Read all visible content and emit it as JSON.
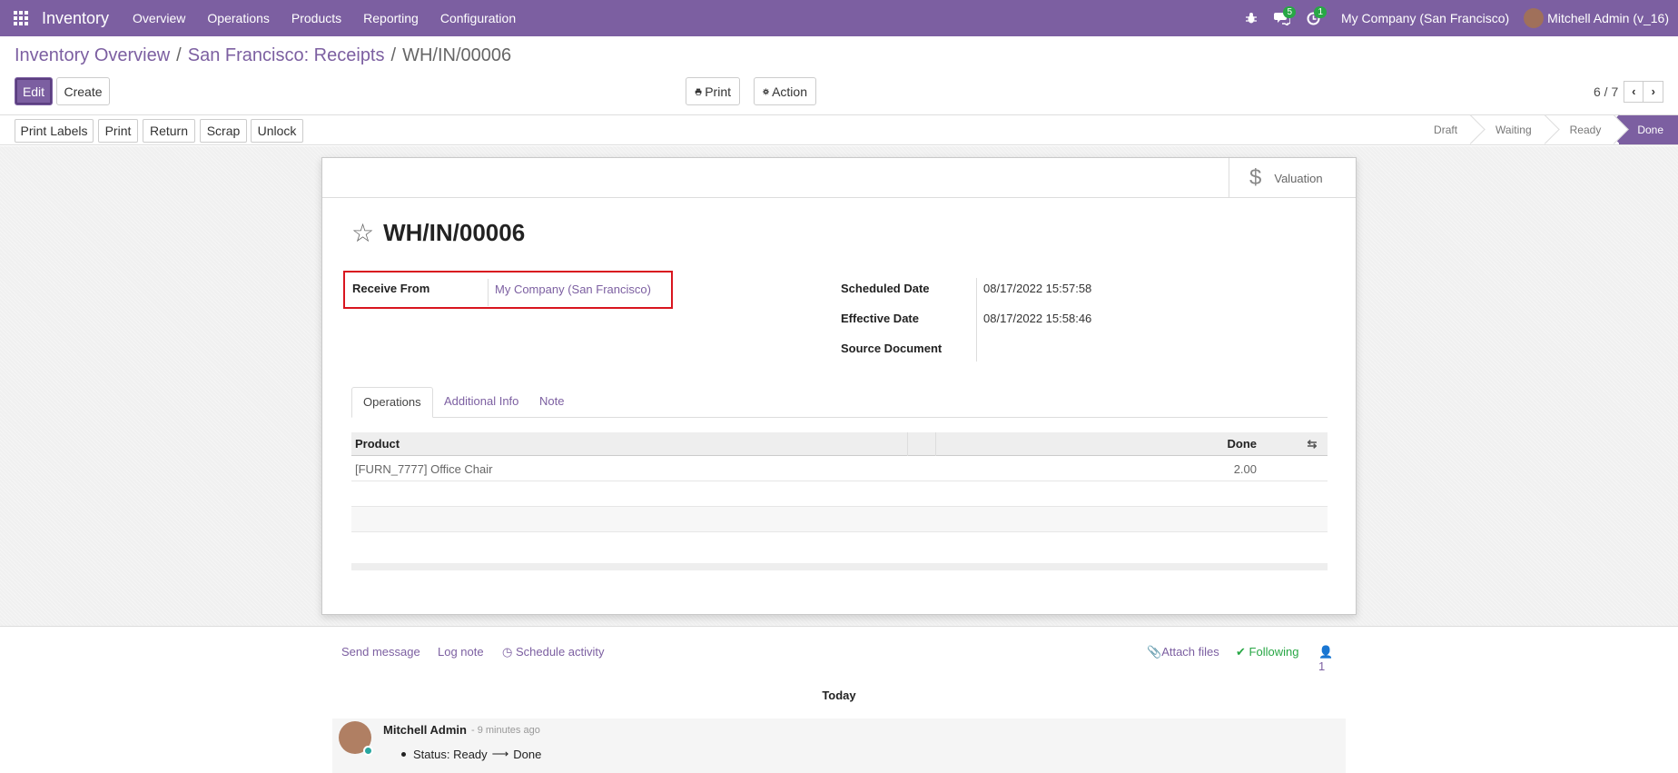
{
  "navbar": {
    "brand": "Inventory",
    "menu": [
      "Overview",
      "Operations",
      "Products",
      "Reporting",
      "Configuration"
    ],
    "messages_badge": "5",
    "activities_badge": "1",
    "company": "My Company (San Francisco)",
    "user": "Mitchell Admin (v_16)"
  },
  "breadcrumb": {
    "items": [
      "Inventory Overview",
      "San Francisco: Receipts"
    ],
    "separator": "/",
    "current": "WH/IN/00006"
  },
  "control": {
    "edit": "Edit",
    "create": "Create",
    "print": "Print",
    "action": "Action",
    "pager": "6 / 7"
  },
  "statusbar": {
    "buttons": [
      "Print Labels",
      "Print",
      "Return",
      "Scrap",
      "Unlock"
    ],
    "stages": [
      "Draft",
      "Waiting",
      "Ready",
      "Done"
    ],
    "active_stage": "Done"
  },
  "form": {
    "smart_button": "Valuation",
    "title": "WH/IN/00006",
    "receive_from_label": "Receive From",
    "receive_from_value": "My Company (San Francisco)",
    "scheduled_date_label": "Scheduled Date",
    "scheduled_date_value": "08/17/2022 15:57:58",
    "effective_date_label": "Effective Date",
    "effective_date_value": "08/17/2022 15:58:46",
    "source_document_label": "Source Document",
    "tabs": [
      "Operations",
      "Additional Info",
      "Note"
    ],
    "table": {
      "headers": [
        "Product",
        "Done"
      ],
      "rows": [
        {
          "product": "[FURN_7777] Office Chair",
          "done": "2.00"
        }
      ]
    }
  },
  "chatter": {
    "send_message": "Send message",
    "log_note": "Log note",
    "schedule_activity": "Schedule activity",
    "attach_files": "Attach files",
    "following": "Following",
    "followers": "1",
    "today": "Today",
    "message": {
      "author": "Mitchell Admin",
      "date": "- 9 minutes ago",
      "body_prefix": "Status: Ready",
      "arrow": "⟶",
      "body_suffix": "Done"
    }
  },
  "colors": {
    "brand": "#7c5fa1",
    "badge": "#28a745",
    "highlight": "#d9151f"
  }
}
